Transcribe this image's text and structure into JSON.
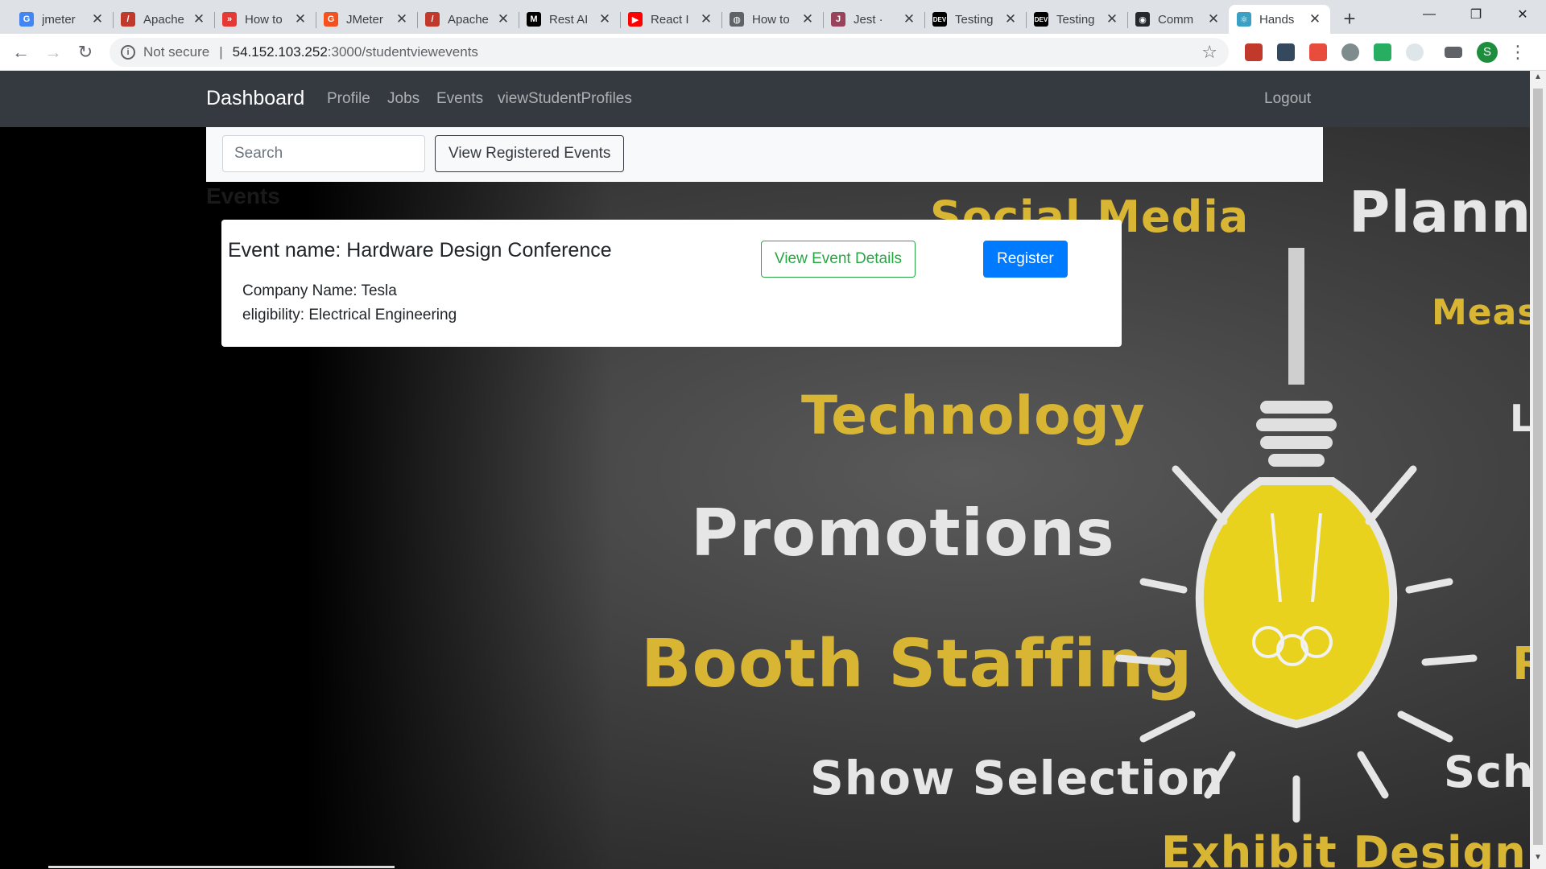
{
  "browser": {
    "tabs": [
      {
        "title": "jmeter",
        "icon": "google-icon",
        "color": "#4285f4",
        "glyph": "G"
      },
      {
        "title": "Apache",
        "icon": "apache-feather-icon",
        "color": "#c0392b",
        "glyph": "/"
      },
      {
        "title": "How to",
        "icon": "blazemeter-icon",
        "color": "#e53935",
        "glyph": "»"
      },
      {
        "title": "JMeter",
        "icon": "jmeter-icon",
        "color": "#f4511e",
        "glyph": "G"
      },
      {
        "title": "Apache",
        "icon": "apache-feather-icon",
        "color": "#c0392b",
        "glyph": "/"
      },
      {
        "title": "Rest AI",
        "icon": "medium-icon",
        "color": "#000000",
        "glyph": "M"
      },
      {
        "title": "React I",
        "icon": "youtube-icon",
        "color": "#ff0000",
        "glyph": "▶"
      },
      {
        "title": "How to",
        "icon": "globe-icon",
        "color": "#5f6368",
        "glyph": "◍"
      },
      {
        "title": "Jest ·",
        "icon": "jest-icon",
        "color": "#99425b",
        "glyph": "J"
      },
      {
        "title": "Testing",
        "icon": "dev-icon",
        "color": "#000000",
        "glyph": "DEV"
      },
      {
        "title": "Testing",
        "icon": "dev-icon",
        "color": "#000000",
        "glyph": "DEV"
      },
      {
        "title": "Comm",
        "icon": "github-icon",
        "color": "#24292e",
        "glyph": "◉"
      },
      {
        "title": "Hands",
        "icon": "react-icon",
        "color": "#3aa1c4",
        "glyph": "⚛",
        "active": true
      }
    ],
    "security_label": "Not secure",
    "url_host": "54.152.103.252",
    "url_rest": ":3000/studentviewevents",
    "profile_initial": "S"
  },
  "navbar": {
    "brand": "Dashboard",
    "links": [
      "Profile",
      "Jobs",
      "Events",
      "viewStudentProfiles"
    ],
    "logout": "Logout"
  },
  "search": {
    "placeholder": "Search",
    "view_registered_label": "View Registered Events"
  },
  "page": {
    "heading": "Events"
  },
  "event": {
    "name_label": "Event name: Hardware Design Conference",
    "company_label": "Company Name: Tesla",
    "eligibility_label": "eligibility: Electrical Engineering",
    "details_button": "View Event Details",
    "register_button": "Register"
  },
  "background_words": {
    "social_media": "Social Media",
    "planning": "Planni",
    "measure": "Meas",
    "technology": "Technology",
    "promotions": "Promotions",
    "booth_staffing": "Booth Staffing",
    "show_selection": "Show Selection",
    "schedule": "Sche",
    "exhibit_design": "Exhibit Design",
    "fragment_l": "L",
    "fragment_r": "R"
  },
  "colors": {
    "navbar": "#343a40",
    "primary": "#007bff",
    "success": "#28a745",
    "chalk_yellow": "#d9b534"
  }
}
